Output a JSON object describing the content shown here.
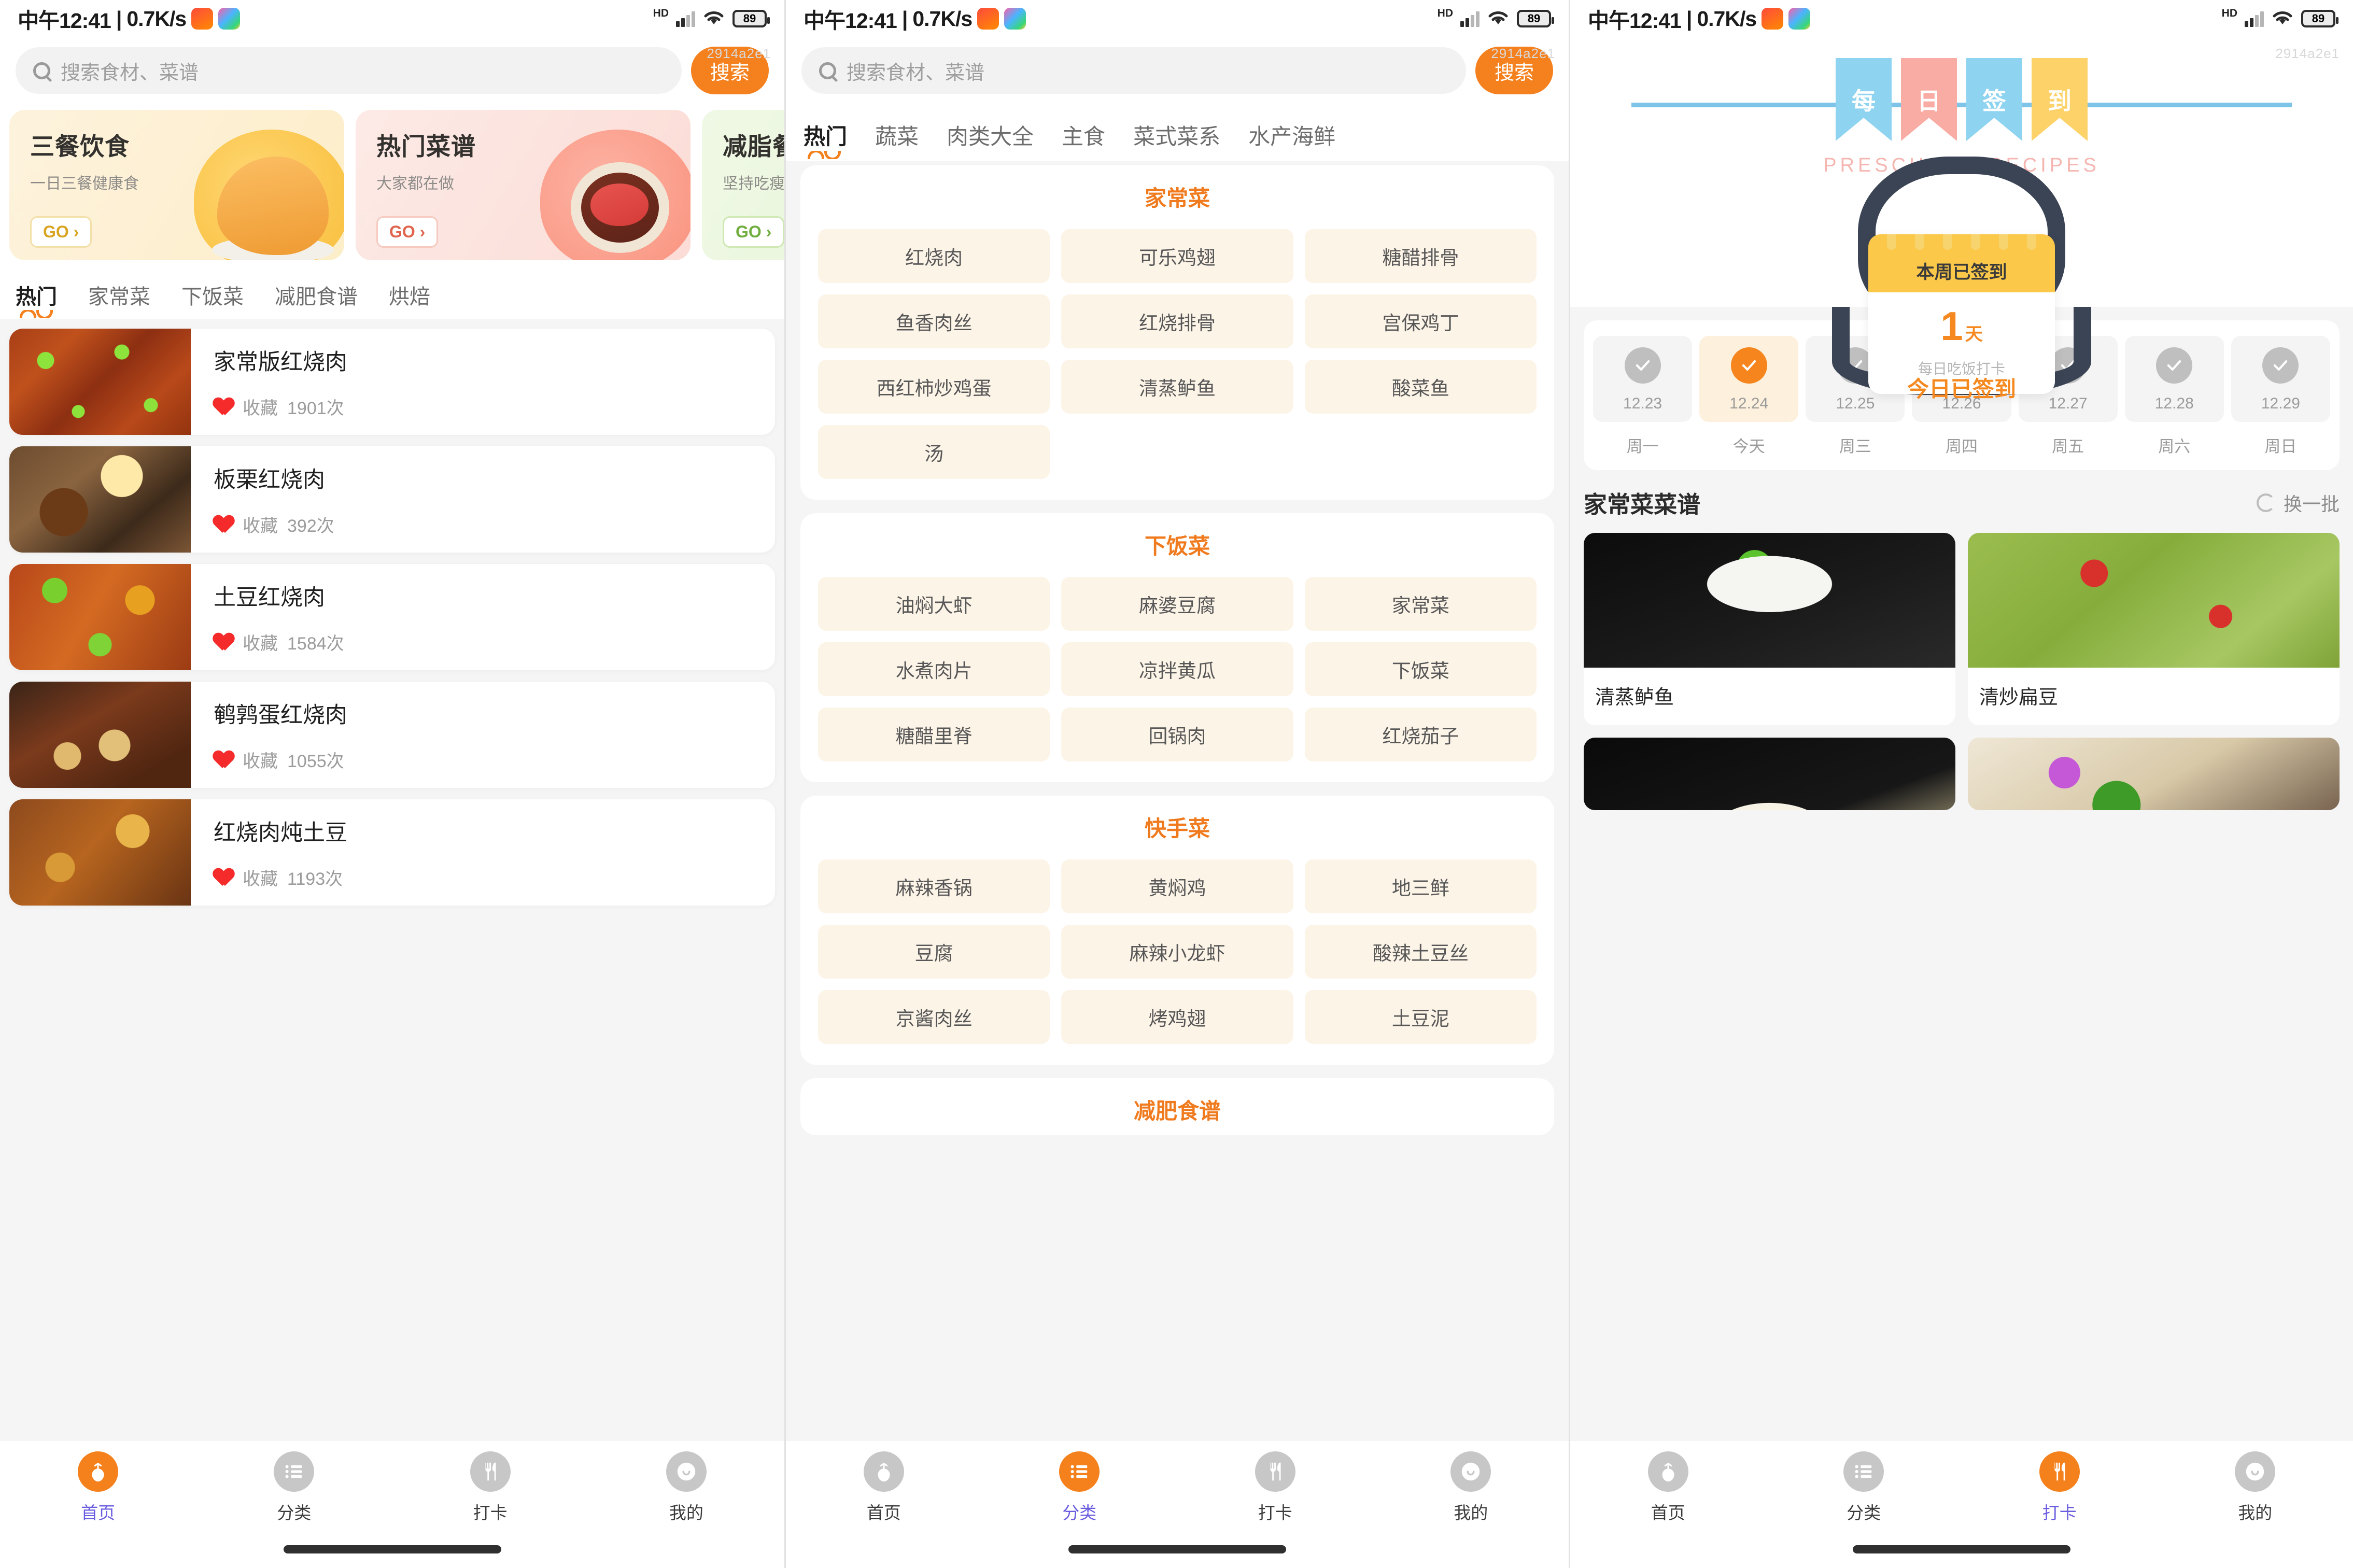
{
  "statusbar": {
    "time": "中午12:41",
    "separator": "|",
    "netspeed": "0.7K/s",
    "hd": "HD",
    "battery": "89"
  },
  "watermark": "2914a2e1",
  "accent_color": "#f5811d",
  "screen1": {
    "search": {
      "placeholder": "搜索食材、菜谱",
      "button": "搜索"
    },
    "banners": [
      {
        "title": "三餐饮食",
        "subtitle": "一日三餐健康食",
        "go": "GO ›",
        "theme": "yellow"
      },
      {
        "title": "热门菜谱",
        "subtitle": "大家都在做",
        "go": "GO ›",
        "theme": "pink"
      },
      {
        "title": "减脂餐",
        "subtitle": "坚持吃瘦下来",
        "go": "GO ›",
        "theme": "green"
      }
    ],
    "tabs": [
      {
        "label": "热门",
        "active": true
      },
      {
        "label": "家常菜",
        "active": false
      },
      {
        "label": "下饭菜",
        "active": false
      },
      {
        "label": "减肥食谱",
        "active": false
      },
      {
        "label": "烘焙",
        "active": false
      }
    ],
    "recipes": [
      {
        "name": "家常版红烧肉",
        "fav_label": "收藏",
        "fav_count": "1901次"
      },
      {
        "name": "板栗红烧肉",
        "fav_label": "收藏",
        "fav_count": "392次"
      },
      {
        "name": "土豆红烧肉",
        "fav_label": "收藏",
        "fav_count": "1584次"
      },
      {
        "name": "鹌鹑蛋红烧肉",
        "fav_label": "收藏",
        "fav_count": "1055次"
      },
      {
        "name": "红烧肉炖土豆",
        "fav_label": "收藏",
        "fav_count": "1193次"
      }
    ]
  },
  "screen2": {
    "search": {
      "placeholder": "搜索食材、菜谱",
      "button": "搜索"
    },
    "tabs": [
      {
        "label": "热门",
        "active": true
      },
      {
        "label": "蔬菜",
        "active": false
      },
      {
        "label": "肉类大全",
        "active": false
      },
      {
        "label": "主食",
        "active": false
      },
      {
        "label": "菜式菜系",
        "active": false
      },
      {
        "label": "水产海鲜",
        "active": false
      }
    ],
    "sections": [
      {
        "title": "家常菜",
        "chips": [
          "红烧肉",
          "可乐鸡翅",
          "糖醋排骨",
          "鱼香肉丝",
          "红烧排骨",
          "宫保鸡丁",
          "西红柿炒鸡蛋",
          "清蒸鲈鱼",
          "酸菜鱼",
          "汤"
        ]
      },
      {
        "title": "下饭菜",
        "chips": [
          "油焖大虾",
          "麻婆豆腐",
          "家常菜",
          "水煮肉片",
          "凉拌黄瓜",
          "下饭菜",
          "糖醋里脊",
          "回锅肉",
          "红烧茄子"
        ]
      },
      {
        "title": "快手菜",
        "chips": [
          "麻辣香锅",
          "黄焖鸡",
          "地三鲜",
          "豆腐",
          "麻辣小龙虾",
          "酸辣土豆丝",
          "京酱肉丝",
          "烤鸡翅",
          "土豆泥"
        ]
      },
      {
        "title": "减肥食谱",
        "chips": []
      }
    ]
  },
  "screen3": {
    "banner": {
      "chars": [
        "每",
        "日",
        "签",
        "到"
      ],
      "subtitle": "PRESCHOOL RECIPES"
    },
    "checkin": {
      "week_label": "本周已签到",
      "days_count": "1",
      "days_unit": "天",
      "caption": "每日吃饭打卡",
      "today_status": "今日已签到"
    },
    "week": [
      {
        "date": "12.23",
        "weekday": "周一",
        "checked": false,
        "today": false
      },
      {
        "date": "12.24",
        "weekday": "今天",
        "checked": true,
        "today": true
      },
      {
        "date": "12.25",
        "weekday": "周三",
        "checked": false,
        "today": false
      },
      {
        "date": "12.26",
        "weekday": "周四",
        "checked": false,
        "today": false
      },
      {
        "date": "12.27",
        "weekday": "周五",
        "checked": false,
        "today": false
      },
      {
        "date": "12.28",
        "weekday": "周六",
        "checked": false,
        "today": false
      },
      {
        "date": "12.29",
        "weekday": "周日",
        "checked": false,
        "today": false
      }
    ],
    "recommend": {
      "title": "家常菜菜谱",
      "refresh_label": "换一批",
      "cards": [
        {
          "name": "清蒸鲈鱼"
        },
        {
          "name": "清炒扁豆"
        }
      ]
    }
  },
  "bottom_nav": {
    "items": [
      {
        "label": "首页",
        "icon": "radish-icon"
      },
      {
        "label": "分类",
        "icon": "list-icon"
      },
      {
        "label": "打卡",
        "icon": "cutlery-icon"
      },
      {
        "label": "我的",
        "icon": "smiley-icon"
      }
    ],
    "active_index": [
      0,
      1,
      2
    ]
  }
}
